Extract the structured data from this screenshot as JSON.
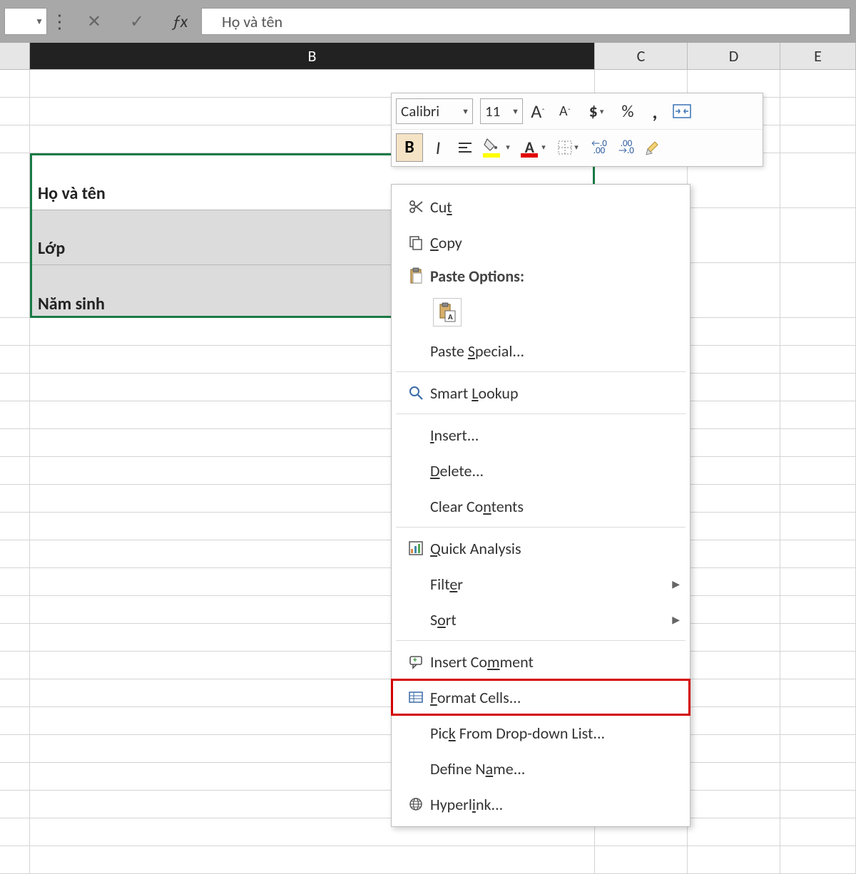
{
  "formula_bar": {
    "value": "Họ và tên"
  },
  "columns": [
    "B",
    "C",
    "D",
    "E"
  ],
  "cells": {
    "b3": "Họ và tên",
    "b4": "Lớp",
    "b5": "Năm sinh"
  },
  "mini_toolbar": {
    "font": "Calibri",
    "size": "11",
    "bold": "B",
    "italic": "I",
    "font_color_letter": "A",
    "dollar": "$",
    "percent": "%",
    "comma": ",",
    "increase_a": "A",
    "decrease_a": "A",
    "dec1": "←.0",
    "dec1b": ".00",
    "dec2": ".00",
    "dec2b": "→.0"
  },
  "context_menu": {
    "cut": "Cut",
    "copy": "Copy",
    "paste_options": "Paste Options:",
    "paste_special": "Paste Special...",
    "smart_lookup": "Smart Lookup",
    "insert": "Insert...",
    "delete": "Delete...",
    "clear_contents": "Clear Contents",
    "quick_analysis": "Quick Analysis",
    "filter": "Filter",
    "sort": "Sort",
    "insert_comment": "Insert Comment",
    "format_cells": "Format Cells...",
    "pick_list": "Pick From Drop-down List...",
    "define_name": "Define Name...",
    "hyperlink": "Hyperlink..."
  }
}
